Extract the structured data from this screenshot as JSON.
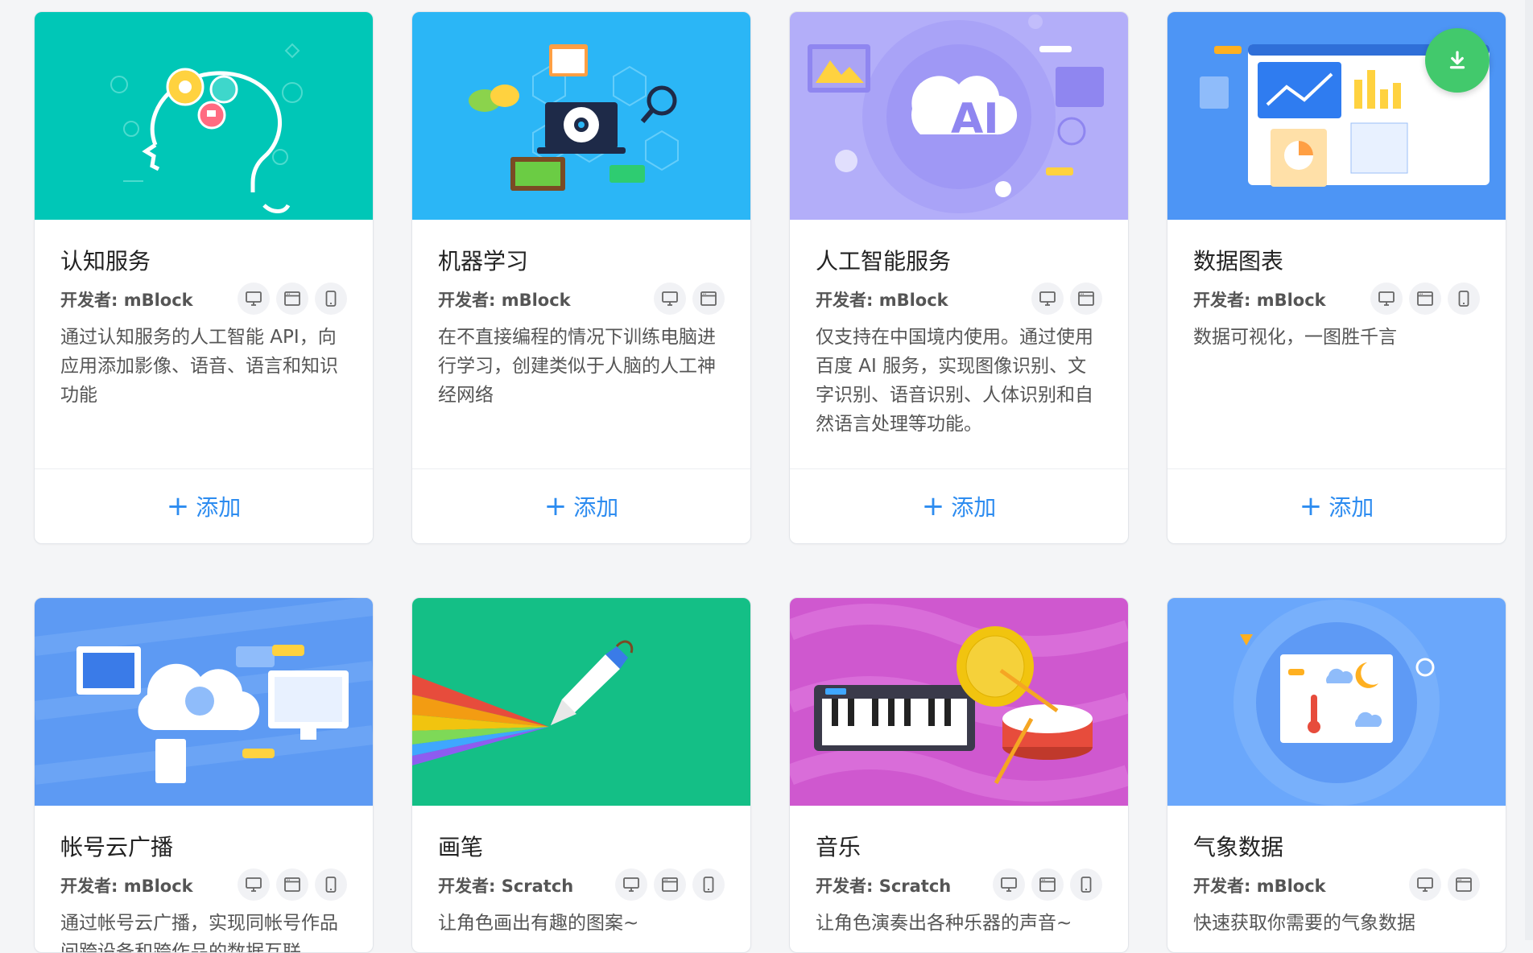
{
  "colors": {
    "accent": "#2d8cf0",
    "download_button": "#42c96c",
    "thumb_cognitive": "#00c7b7",
    "thumb_ml": "#2bb6f6",
    "thumb_ai": "#b3aef9",
    "thumb_chart": "#4d95f5",
    "thumb_cloud": "#5d9af3",
    "thumb_pen": "#14bf86",
    "thumb_music": "#cf58cf",
    "thumb_weather": "#6aa7fb"
  },
  "cards": [
    {
      "title": "认知服务",
      "developer": "开发者: mBlock",
      "platforms": [
        "desktop-icon",
        "browser-icon",
        "mobile-icon"
      ],
      "description": "通过认知服务的人工智能 API，向应用添加影像、语音、语言和知识功能",
      "add_label": "添加"
    },
    {
      "title": "机器学习",
      "developer": "开发者: mBlock",
      "platforms": [
        "desktop-icon",
        "browser-icon"
      ],
      "description": "在不直接编程的情况下训练电脑进行学习，创建类似于人脑的人工神经网络",
      "add_label": "添加"
    },
    {
      "title": "人工智能服务",
      "developer": "开发者: mBlock",
      "platforms": [
        "desktop-icon",
        "browser-icon"
      ],
      "description": "仅支持在中国境内使用。通过使用百度 AI 服务，实现图像识别、文字识别、语音识别、人体识别和自然语言处理等功能。",
      "add_label": "添加",
      "thumb_text": "AI"
    },
    {
      "title": "数据图表",
      "developer": "开发者: mBlock",
      "platforms": [
        "desktop-icon",
        "browser-icon",
        "mobile-icon"
      ],
      "description": "数据可视化，一图胜千言",
      "add_label": "添加",
      "has_download": true,
      "download_icon": "download-icon"
    },
    {
      "title": "帐号云广播",
      "developer": "开发者: mBlock",
      "platforms": [
        "desktop-icon",
        "browser-icon",
        "mobile-icon"
      ],
      "description": "通过帐号云广播，实现同帐号作品间跨设备和跨作品的数据互联"
    },
    {
      "title": "画笔",
      "developer": "开发者: Scratch",
      "platforms": [
        "desktop-icon",
        "browser-icon",
        "mobile-icon"
      ],
      "description": "让角色画出有趣的图案~"
    },
    {
      "title": "音乐",
      "developer": "开发者: Scratch",
      "platforms": [
        "desktop-icon",
        "browser-icon",
        "mobile-icon"
      ],
      "description": "让角色演奏出各种乐器的声音~"
    },
    {
      "title": "气象数据",
      "developer": "开发者: mBlock",
      "platforms": [
        "desktop-icon",
        "browser-icon"
      ],
      "description": "快速获取你需要的气象数据"
    }
  ]
}
